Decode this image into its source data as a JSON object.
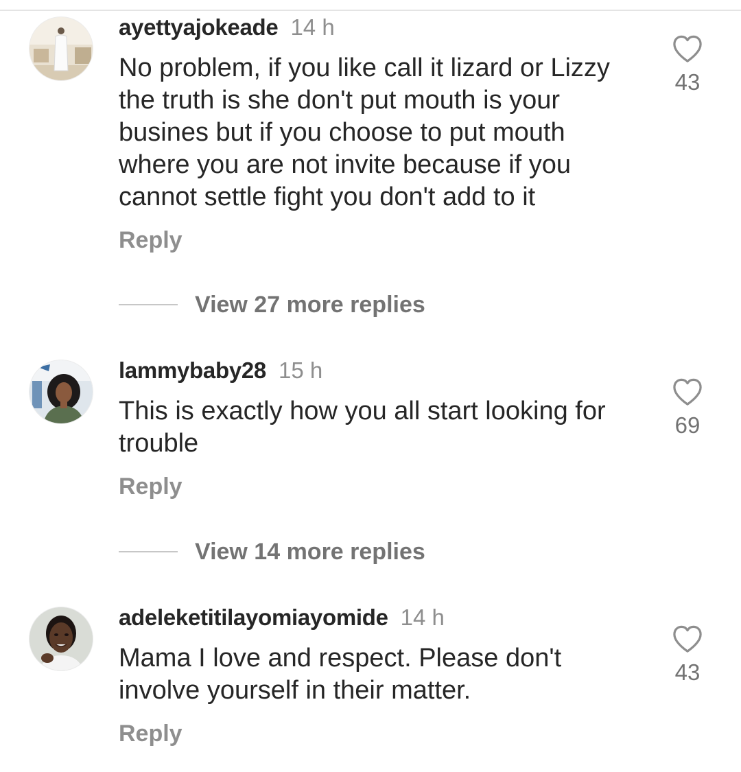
{
  "comments": [
    {
      "username": "ayettyajokeade",
      "time": "14 h",
      "lines": [
        "No problem, if you like call it lizard or Lizzy",
        "the truth is she don't put mouth is your",
        "busines but if you choose to put mouth",
        "where you are not invite because if you",
        "cannot settle fight you don't add to it"
      ],
      "reply_label": "Reply",
      "likes": "43",
      "view_replies": "View 27 more replies"
    },
    {
      "username": "lammybaby28",
      "time": "15 h",
      "lines": [
        "This is exactly how you all start looking for",
        "trouble"
      ],
      "reply_label": "Reply",
      "likes": "69",
      "view_replies": "View 14 more replies"
    },
    {
      "username": "adeleketitilayomiayomide",
      "time": "14 h",
      "lines": [
        "Mama I love and respect. Please don't",
        "involve yourself in their matter."
      ],
      "reply_label": "Reply",
      "likes": "43"
    }
  ],
  "icons": {
    "like": "heart-outline-icon"
  },
  "colors": {
    "text": "#262626",
    "secondary": "#8e8e8e",
    "divider": "#c7c7c7"
  }
}
